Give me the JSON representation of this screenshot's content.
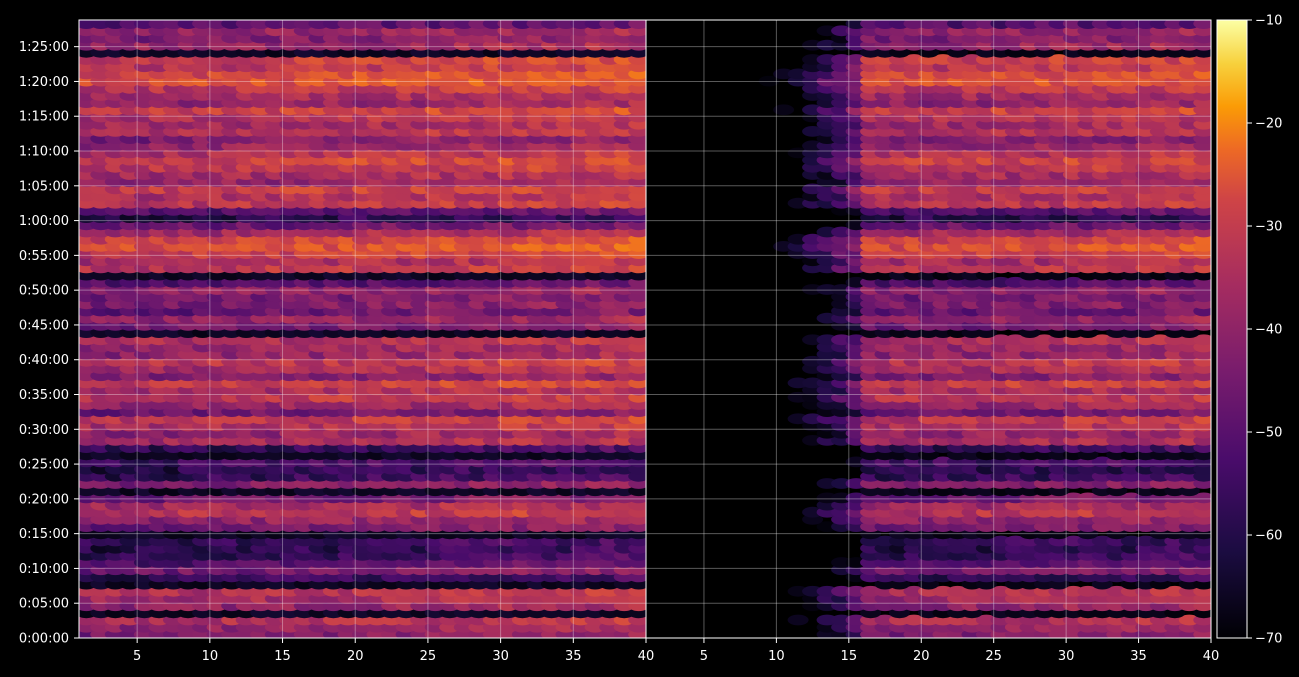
{
  "chart_data": {
    "type": "heatmap",
    "title": "",
    "xlabel": "",
    "ylabel": "",
    "panels": [
      {
        "name": "",
        "xlim": [
          1,
          40
        ],
        "x_ticks": [
          5,
          10,
          15,
          20,
          25,
          30,
          35,
          40
        ],
        "y_tick_labels_shown": true
      },
      {
        "name": "",
        "xlim": [
          1,
          40
        ],
        "x_ticks": [
          5,
          10,
          15,
          20,
          25,
          30,
          35,
          40
        ],
        "y_tick_labels_shown": false
      }
    ],
    "x_tick_labels": [
      "5",
      "10",
      "15",
      "20",
      "25",
      "30",
      "35",
      "40"
    ],
    "y_ticks": [
      "0:00:00",
      "0:05:00",
      "0:10:00",
      "0:15:00",
      "0:20:00",
      "0:25:00",
      "0:30:00",
      "0:35:00",
      "0:40:00",
      "0:45:00",
      "0:50:00",
      "0:55:00",
      "1:00:00",
      "1:05:00",
      "1:10:00",
      "1:15:00",
      "1:20:00",
      "1:25:00"
    ],
    "y_tick_seconds": [
      0,
      300,
      600,
      900,
      1200,
      1500,
      1800,
      2100,
      2400,
      2700,
      3000,
      3300,
      3600,
      3900,
      4200,
      4500,
      4800,
      5100
    ],
    "ylim_seconds": [
      0,
      5330
    ],
    "grid": true,
    "colormap": "inferno",
    "colorbar": {
      "min": -70,
      "max": -10,
      "ticks": [
        -10,
        -20,
        -30,
        -40,
        -50,
        -60,
        -70
      ],
      "tick_labels": [
        "−10",
        "−20",
        "−30",
        "−40",
        "−50",
        "−60",
        "−70"
      ]
    },
    "row_levels_dB": [
      -48,
      -45,
      -40,
      -70,
      -45,
      -42,
      -40,
      -70,
      -60,
      -50,
      -55,
      -60,
      -62,
      -60,
      -70,
      -50,
      -45,
      -38,
      -42,
      -50,
      -70,
      -48,
      -60,
      -62,
      -58,
      -70,
      -60,
      -42,
      -45,
      -40,
      -38,
      -50,
      -44,
      -38,
      -42,
      -36,
      -48,
      -42,
      -38,
      -45,
      -44,
      -40,
      -70,
      -50,
      -45,
      -52,
      -48,
      -50,
      -46,
      -55,
      -70,
      -38,
      -42,
      -36,
      -32,
      -34,
      -42,
      -52,
      -62,
      -55,
      -38,
      -40,
      -36,
      -45,
      -42,
      -38,
      -35,
      -40,
      -44,
      -48,
      -40,
      -42,
      -40,
      -35,
      -45,
      -42,
      -38,
      -32,
      -33,
      -38,
      -36,
      -70,
      -44,
      -48,
      -45,
      -55
    ],
    "right_panel_onset_x": 12
  }
}
